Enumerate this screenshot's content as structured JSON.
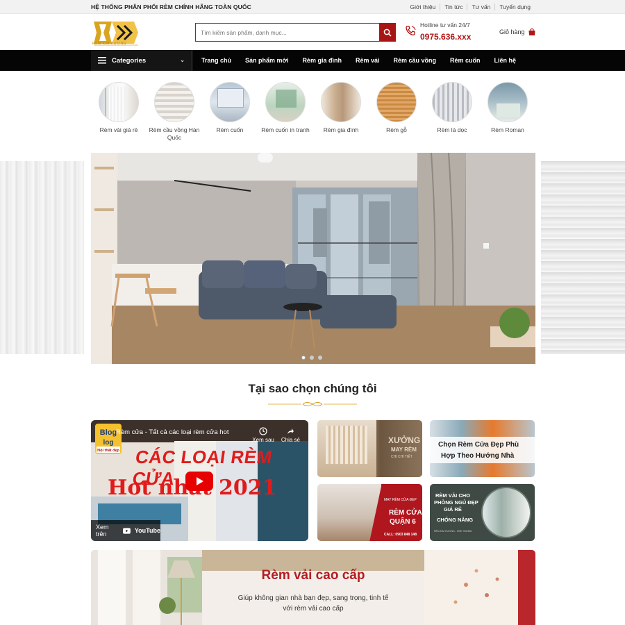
{
  "topbar": {
    "tagline": "HỆ THỐNG PHÂN PHỐI RÈM CHÍNH HÃNG TOÀN QUỐC",
    "links": [
      "Giới thiệu",
      "Tin tức",
      "Tư vấn",
      "Tuyển dụng"
    ]
  },
  "header": {
    "logo_text": "RÈM KIM HƯƠNG",
    "search_placeholder": "Tìm kiếm sản phẩm, danh mục...",
    "hotline_label": "Hotline tư vấn 24/7",
    "hotline_number": "0975.636.xxx",
    "cart_label": "Giỏ hàng"
  },
  "nav": {
    "categories_label": "Categories",
    "items": [
      "Trang chủ",
      "Sản phẩm mới",
      "Rèm gia đình",
      "Rèm vải",
      "Rèm cầu vồng",
      "Rèm cuốn",
      "Liên hệ"
    ]
  },
  "categories": [
    {
      "label": "Rèm vải giá rẻ",
      "icon": "fabric-curtain"
    },
    {
      "label": "Rèm cầu vồng Hàn Quốc",
      "icon": "zebra-blind"
    },
    {
      "label": "Rèm cuốn",
      "icon": "roller-blind"
    },
    {
      "label": "Rèm cuốn in tranh",
      "icon": "printed-roller"
    },
    {
      "label": "Rèm gia đình",
      "icon": "home-curtain"
    },
    {
      "label": "Rèm gỗ",
      "icon": "wood-blind"
    },
    {
      "label": "Rèm lá dọc",
      "icon": "vertical-blind"
    },
    {
      "label": "Rèm Roman",
      "icon": "roman-blind"
    }
  ],
  "banner": {
    "slides": 3,
    "active_slide": 1
  },
  "why_section": {
    "title": "Tại sao chọn chúng tôi"
  },
  "video": {
    "channel_badge": "Blog",
    "channel_sub": "Nội thất đẹp",
    "title": "Rèm cửa - Tất cả các loại rèm cửa hot",
    "watch_later": "Xem sau",
    "share": "Chia sẻ",
    "headline_1": "CÁC LOẠI RÈM CỬA",
    "headline_2": "Hot nhất 2021",
    "watch_on": "Xem trên",
    "youtube": "YouTube"
  },
  "tiles": [
    {
      "line1": "XƯỞNG",
      "line2": "MAY RÈM",
      "line3": "CHỊ CHI TIẾT"
    },
    {
      "line1": "Chọn Rèm Cửa Đẹp Phù",
      "line2": "Hợp Theo Hướng Nhà"
    },
    {
      "line1": "MAY RÈM CỬA ĐẸP",
      "line2": "RÈM CỬA",
      "line3": "QUẬN 6",
      "line4": "CALL: 0903 848 148"
    },
    {
      "line1": "RÈM VẢI CHO",
      "line2": "PHÒNG NGỦ ĐẸP",
      "line3": "GIÁ RẺ",
      "line4": "CHỐNG NẮNG",
      "line5": "RÈM KIM HƯƠNG - 0987 766 866"
    }
  ],
  "promo": {
    "title": "Rèm vải cao cấp",
    "desc": "Giúp không gian nhà bạn đẹp, sang trọng, tinh tế với rèm vải cao cấp"
  },
  "colors": {
    "accent": "#b11616",
    "nav_bg": "#050505",
    "gold": "#d4a017"
  }
}
